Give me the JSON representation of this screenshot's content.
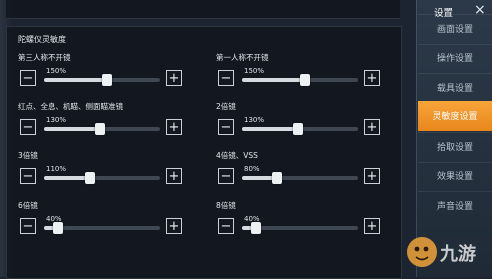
{
  "sidebar": {
    "title": "设置",
    "close_icon": "close-icon",
    "items": [
      {
        "label": "画面设置",
        "active": false
      },
      {
        "label": "操作设置",
        "active": false
      },
      {
        "label": "载具设置",
        "active": false
      },
      {
        "label": "灵敏度设置",
        "active": true
      },
      {
        "label": "拾取设置",
        "active": false
      },
      {
        "label": "效果设置",
        "active": false
      },
      {
        "label": "声音设置",
        "active": false
      }
    ]
  },
  "section": {
    "title": "陀螺仪灵敏度"
  },
  "settings": [
    {
      "label": "第三人称不开镜",
      "value": "150%",
      "fraction": 0.54
    },
    {
      "label": "第一人称不开镜",
      "value": "150%",
      "fraction": 0.54
    },
    {
      "label": "红点、全息、机瞄、侧面瞄准镜",
      "value": "130%",
      "fraction": 0.48
    },
    {
      "label": "2倍镜",
      "value": "130%",
      "fraction": 0.48
    },
    {
      "label": "3倍镜",
      "value": "110%",
      "fraction": 0.4
    },
    {
      "label": "4倍镜、VSS",
      "value": "80%",
      "fraction": 0.3
    },
    {
      "label": "6倍镜",
      "value": "40%",
      "fraction": 0.12
    },
    {
      "label": "8倍镜",
      "value": "40%",
      "fraction": 0.12
    }
  ],
  "controls": {
    "minus": "−",
    "plus": "+"
  },
  "watermark": {
    "text": "九游"
  },
  "colors": {
    "accent": "#f29a2e",
    "panel": "#121820"
  }
}
